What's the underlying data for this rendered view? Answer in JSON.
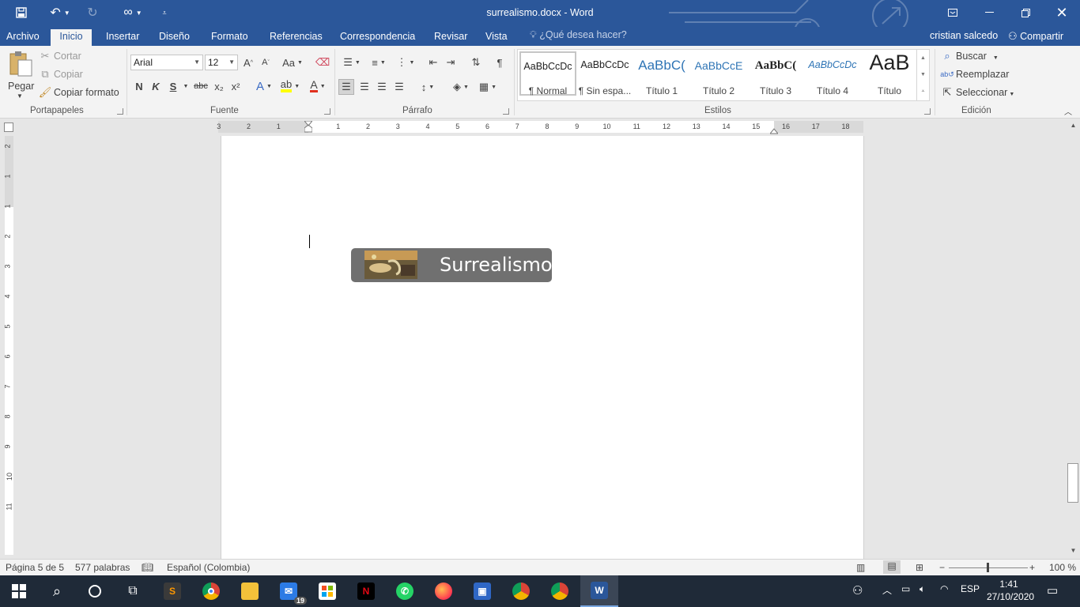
{
  "window": {
    "title": "surrealismo.docx - Word"
  },
  "quick_access": {
    "save_icon": "save-icon",
    "undo_icon": "undo-icon",
    "redo_icon": "redo-icon",
    "touch_icon": "touch-mode-icon",
    "customize_icon": "customize-icon"
  },
  "tabs": [
    "Archivo",
    "Inicio",
    "Insertar",
    "Diseño",
    "Formato",
    "Referencias",
    "Correspondencia",
    "Revisar",
    "Vista"
  ],
  "active_tab": "Inicio",
  "tell_me": "¿Qué desea hacer?",
  "user": {
    "name": "cristian salcedo",
    "share_label": "Compartir"
  },
  "ribbon": {
    "clipboard": {
      "paste": "Pegar",
      "cut": "Cortar",
      "copy": "Copiar",
      "format_painter": "Copiar formato",
      "label": "Portapapeles"
    },
    "font": {
      "family": "Arial",
      "size": "12",
      "label": "Fuente",
      "bold": "N",
      "italic": "K",
      "underline": "S",
      "strike": "abc",
      "sub": "x₂",
      "sup": "x²",
      "case": "Aa"
    },
    "paragraph": {
      "label": "Párrafo"
    },
    "styles": {
      "label": "Estilos",
      "items": [
        {
          "preview": "AaBbCcDc",
          "name": "¶ Normal"
        },
        {
          "preview": "AaBbCcDc",
          "name": "¶ Sin espa..."
        },
        {
          "preview": "AaBbC(",
          "name": "Título 1"
        },
        {
          "preview": "AaBbCcE",
          "name": "Título 2"
        },
        {
          "preview": "AaBbC(",
          "name": "Título 3"
        },
        {
          "preview": "AaBbCcDc",
          "name": "Título 4"
        },
        {
          "preview": "AaB",
          "name": "Título"
        }
      ]
    },
    "editing": {
      "label": "Edición",
      "find": "Buscar",
      "replace": "Reemplazar",
      "select": "Seleccionar"
    }
  },
  "ruler": {
    "h_numbers": [
      "3",
      "2",
      "1",
      "1",
      "2",
      "3",
      "4",
      "5",
      "6",
      "7",
      "8",
      "9",
      "10",
      "11",
      "12",
      "13",
      "14",
      "15",
      "16",
      "17",
      "18"
    ],
    "v_numbers": [
      "2",
      "1",
      "1",
      "2",
      "3",
      "4",
      "5",
      "6",
      "7",
      "8",
      "9",
      "10",
      "11"
    ]
  },
  "document": {
    "banner_text": "Surrealismo"
  },
  "status": {
    "page": "Página 5 de 5",
    "words": "577 palabras",
    "language": "Español (Colombia)",
    "zoom": "100 %"
  },
  "taskbar": {
    "mail_badge": "19",
    "language": "ESP",
    "time": "1:41",
    "date": "27/10/2020"
  },
  "colors": {
    "word_blue": "#2b579a",
    "ribbon_bg": "#f3f3f3",
    "taskbar": "#1f2a38"
  }
}
